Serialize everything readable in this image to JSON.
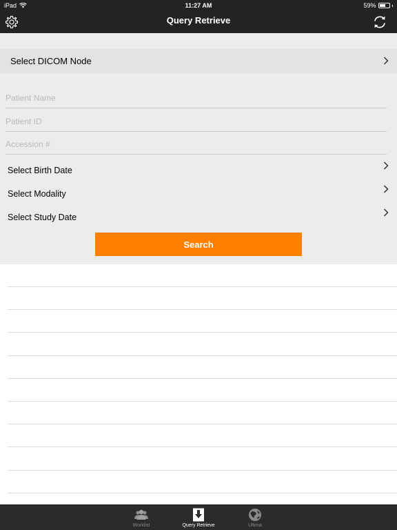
{
  "status_bar": {
    "carrier": "iPad",
    "time": "11:27 AM",
    "battery": "59%",
    "battery_level": 0.59
  },
  "navbar": {
    "title": "Query Retrieve",
    "left_icon": "gear-icon",
    "right_icon": "refresh-icon"
  },
  "form": {
    "dicom_node_label": "Select DICOM Node",
    "patient_name": {
      "value": "",
      "placeholder": "Patient Name"
    },
    "patient_id": {
      "value": "",
      "placeholder": "Patient ID"
    },
    "accession": {
      "value": "",
      "placeholder": "Accession #"
    },
    "birth_date_label": "Select Birth Date",
    "modality_label": "Select Modality",
    "study_date_label": "Select Study Date",
    "search_label": "Search"
  },
  "results": {
    "row_count": 10
  },
  "tabbar": {
    "tabs": [
      {
        "label": "Worklist",
        "icon": "users-icon",
        "active": false
      },
      {
        "label": "Query Retrieve",
        "icon": "download-icon",
        "active": true
      },
      {
        "label": "Ultima",
        "icon": "globe-icon",
        "active": false
      }
    ]
  },
  "colors": {
    "header_bg": "#222324",
    "form_bg": "#ececec",
    "accent": "#ff8000",
    "tabbar_bg": "#2b2b2b"
  }
}
